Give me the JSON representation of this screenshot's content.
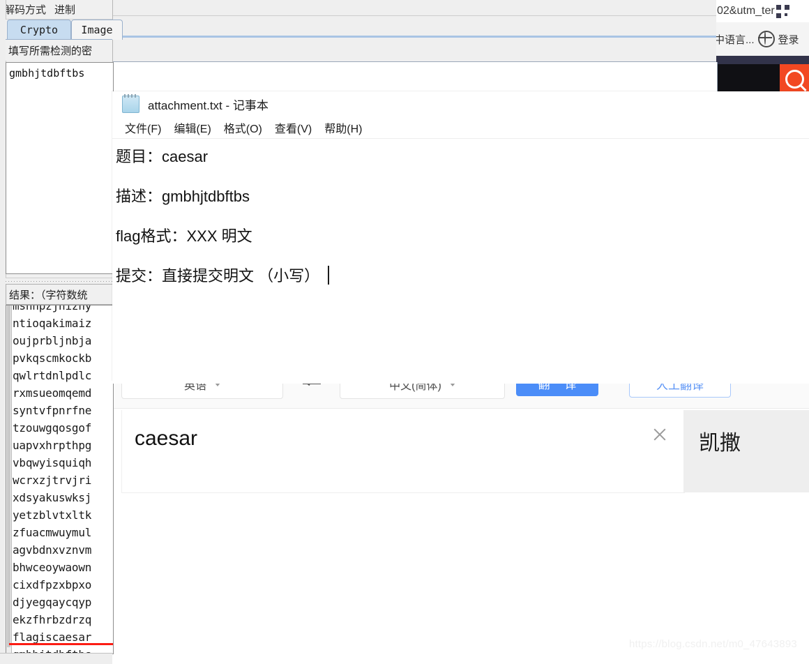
{
  "browser": {
    "url_fragment": "02&utm_ter",
    "qr_icon": "qr-code-icon",
    "language_menu": "中语言...",
    "globe_icon": "globe-icon",
    "login_label": "登录",
    "search_icon": "search-icon"
  },
  "translate": {
    "source_language": "英语",
    "target_language": "中文(简体)",
    "swap_icon": "swap-arrow-icon",
    "translate_button": "翻 译",
    "human_translate_button": "人工翻译",
    "source_text": "caesar",
    "clear_icon": "close-icon",
    "result_text": "凯撒",
    "caret_icon": "chevron-down-icon"
  },
  "watermark": "https://blog.csdn.net/m0_47643893",
  "tool": {
    "menus": [
      "解码方式",
      "进制"
    ],
    "tabs": [
      {
        "label": "Crypto",
        "selected": true
      },
      {
        "label": "Image",
        "selected": false
      }
    ],
    "hint": "填写所需检测的密",
    "input_value": "gmbhjtdbftbs",
    "result_label": "结果：（字符数统",
    "results": [
      "msnnpzjnizhy",
      "ntioqakimaiz",
      "oujprbljnbja",
      "pvkqscmkockb",
      "qwlrtdnlpdlc",
      "rxmsueomqemd",
      "syntvfpnrfne",
      "tzouwgqosgof",
      "uapvxhrpthpg",
      "vbqwyisquiqh",
      "wcrxzjtrvjri",
      "xdsyakuswksj",
      "yetzblvtxltk",
      "zfuacmwuymul",
      "agvbdnxvznvm",
      "bhwceoywaown",
      "cixdfpzxbpxo",
      "djyegqaycqyp",
      "ekzfhrbzdrzq",
      "flagiscaesar",
      "gmbhjtdbftbs"
    ],
    "highlighted_result": "flagiscaesar",
    "highlight_color": "#fc1c13"
  },
  "notepad": {
    "title": "attachment.txt - 记事本",
    "icon": "notepad-icon",
    "menus": [
      "文件(F)",
      "编辑(E)",
      "格式(O)",
      "查看(V)",
      "帮助(H)"
    ],
    "lines": [
      "题目：caesar",
      "描述：gmbhjtdbftbs",
      "flag格式：XXX 明文",
      "提交：直接提交明文 （小写）"
    ]
  },
  "colors": {
    "accent_blue": "#4b8df8",
    "tab_selected": "#c7dcf0",
    "search_orange": "#f24822",
    "underline_red": "#fc1c13"
  }
}
